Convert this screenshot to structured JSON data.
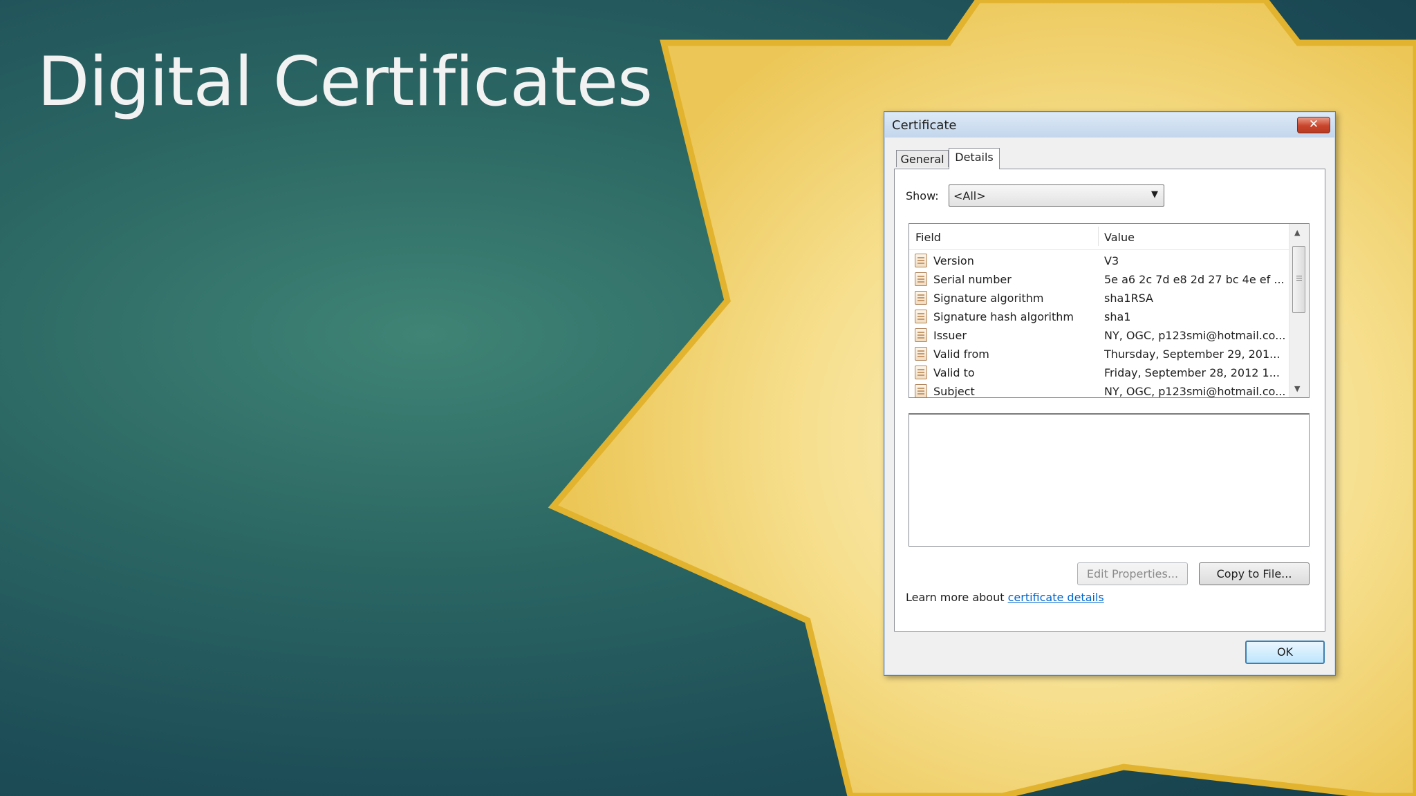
{
  "slide": {
    "title": "Digital Certificates"
  },
  "colors": {
    "background": "#1f5059",
    "accent": "#e8bd3c",
    "starFill": "#f6df8e",
    "link": "#0066cc"
  },
  "dialog": {
    "title": "Certificate",
    "close_glyph": "✕",
    "tabs": [
      {
        "label": "General",
        "active": false
      },
      {
        "label": "Details",
        "active": true
      }
    ],
    "show": {
      "label": "Show:",
      "selected": "<All>",
      "arrow_icon": "dropdown-arrow-icon"
    },
    "table": {
      "columns": [
        "Field",
        "Value"
      ],
      "rows": [
        {
          "field": "Version",
          "value": "V3"
        },
        {
          "field": "Serial number",
          "value": "5e a6 2c 7d e8 2d 27 bc 4e ef ..."
        },
        {
          "field": "Signature algorithm",
          "value": "sha1RSA"
        },
        {
          "field": "Signature hash algorithm",
          "value": "sha1"
        },
        {
          "field": "Issuer",
          "value": "NY, OGC, p123smi@hotmail.co..."
        },
        {
          "field": "Valid from",
          "value": "Thursday, September 29, 201..."
        },
        {
          "field": "Valid to",
          "value": "Friday, September 28, 2012 1..."
        },
        {
          "field": "Subject",
          "value": "NY, OGC, p123smi@hotmail.co..."
        }
      ]
    },
    "buttons": {
      "edit_properties": "Edit Properties...",
      "copy_to_file": "Copy to File...",
      "ok": "OK"
    },
    "learn_more": {
      "prefix": "Learn more about ",
      "link_text": "certificate details"
    }
  }
}
